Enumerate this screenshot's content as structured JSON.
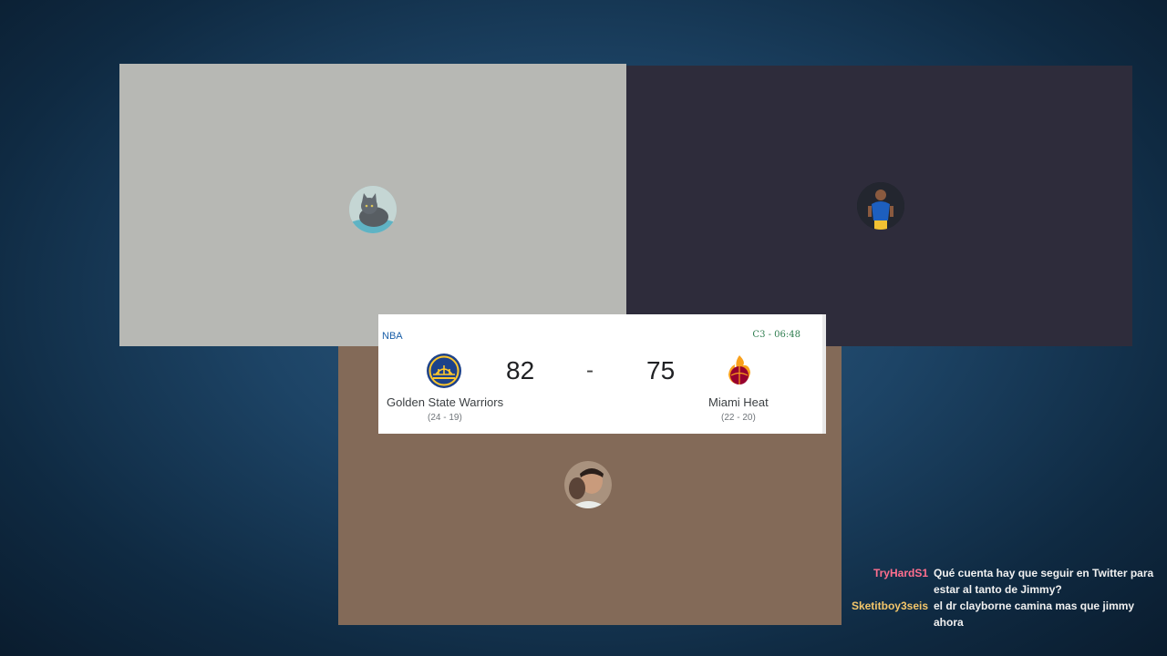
{
  "scoreboard": {
    "league": "NBA",
    "clock": "C3 - 06:48",
    "separator": "-",
    "home": {
      "name": "Golden State Warriors",
      "score": "82",
      "record": "(24 - 19)",
      "color": "#1d428a"
    },
    "away": {
      "name": "Miami Heat",
      "score": "75",
      "record": "(22 - 20)",
      "color": "#98002e"
    }
  },
  "tiles": [
    {
      "avatar": "cat-avatar",
      "bg": "#b7b8b4"
    },
    {
      "avatar": "player-avatar",
      "bg": "#2e2c3b"
    },
    {
      "avatar": "person-avatar",
      "bg": "#836a58"
    }
  ],
  "chat": [
    {
      "user": "TryHardS1",
      "color": "#ff6f8e",
      "message": "Qué cuenta hay que seguir en Twitter para estar al tanto de Jimmy?"
    },
    {
      "user": "Sketitboy3seis",
      "color": "#f4c66a",
      "message": "el dr clayborne camina mas que jimmy ahora"
    }
  ]
}
